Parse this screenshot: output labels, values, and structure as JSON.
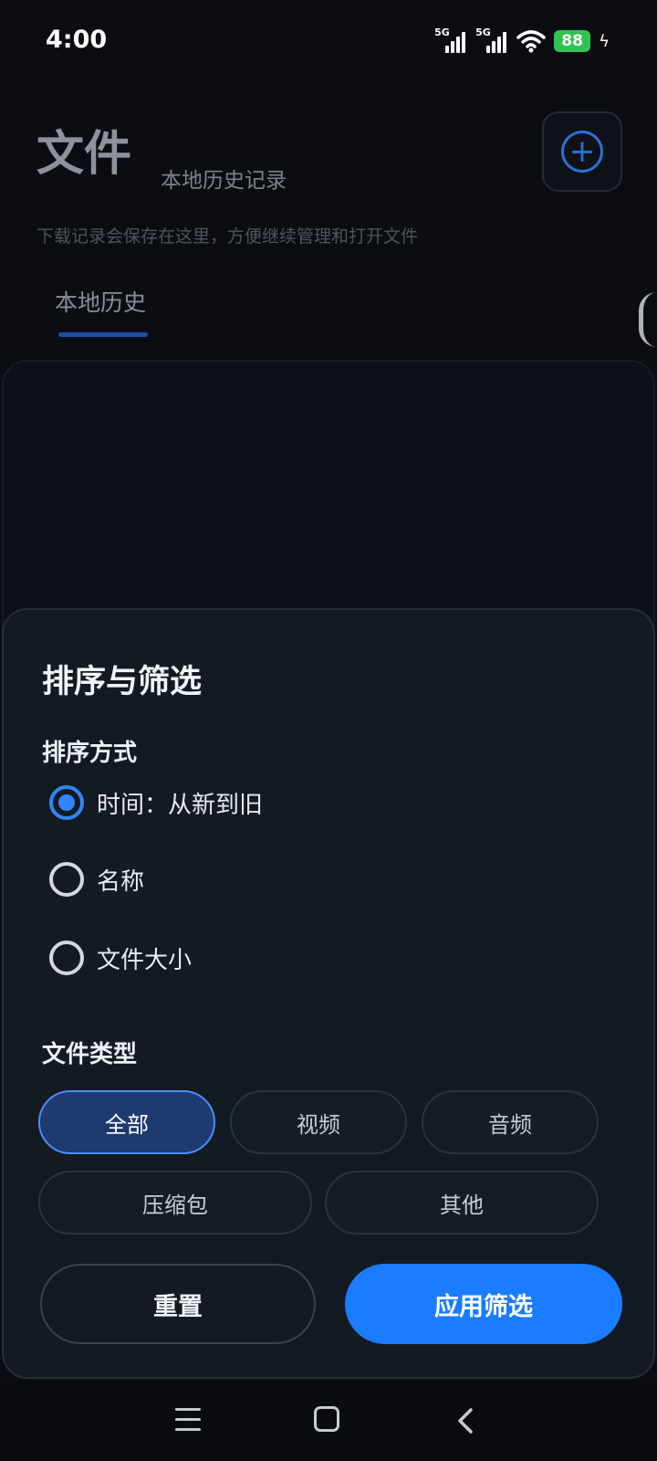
{
  "status": {
    "time": "4:00",
    "signal1": "5G",
    "signal2": "5G",
    "battery": "88"
  },
  "page": {
    "title": "文件",
    "subtitle": "本地历史记录",
    "description": "下载记录会保存在这里，方便继续管理和打开文件",
    "tab_label": "本地历史",
    "add_icon": "+"
  },
  "sheet": {
    "title": "排序与筛选",
    "sort_label": "排序方式",
    "sort_options": [
      {
        "label": "时间：从新到旧",
        "checked": true
      },
      {
        "label": "名称",
        "checked": false
      },
      {
        "label": "文件大小",
        "checked": false
      }
    ],
    "type_label": "文件类型",
    "type_chips": [
      {
        "label": "全部",
        "selected": true
      },
      {
        "label": "视频",
        "selected": false
      },
      {
        "label": "音频",
        "selected": false
      },
      {
        "label": "压缩包",
        "selected": false
      },
      {
        "label": "其他",
        "selected": false
      }
    ],
    "reset_label": "重置",
    "apply_label": "应用筛选"
  },
  "colors": {
    "accent": "#1a7cff",
    "sheet_bg": "#141a22",
    "battery": "#2fc44f"
  },
  "icons": {
    "add": "plus-circle-icon",
    "nav_menu": "menu-icon",
    "nav_home": "home-square-icon",
    "nav_back": "back-chevron-icon"
  }
}
